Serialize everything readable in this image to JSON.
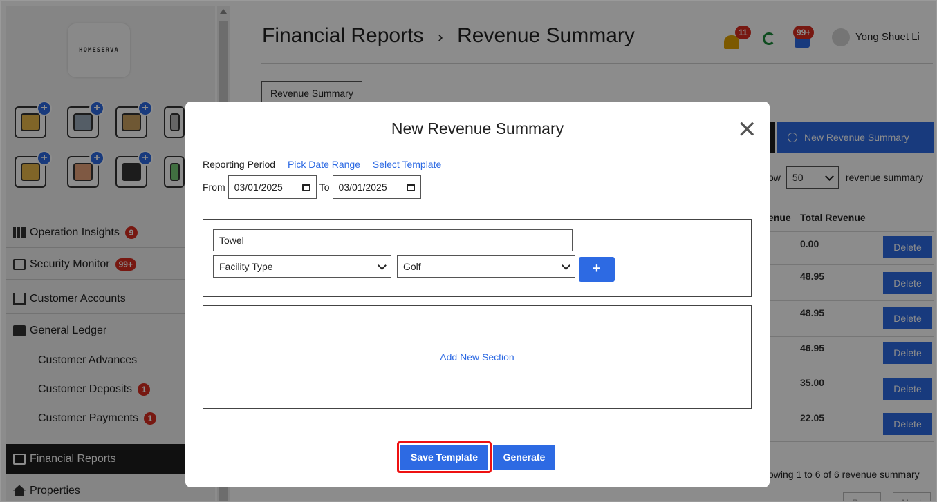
{
  "app": {
    "logo_text": "HOMESERVA"
  },
  "header": {
    "title": "Financial Reports",
    "separator": "›",
    "subtitle": "Revenue Summary",
    "notif_count": "11",
    "message_count": "99+",
    "user_name": "Yong Shuet Li"
  },
  "tabs": [
    {
      "label": "Revenue Summary"
    }
  ],
  "sidebar": {
    "items": [
      {
        "label": "Operation Insights",
        "badge": "9"
      },
      {
        "label": "Security Monitor",
        "badge": "99+"
      },
      {
        "label": "Customer Accounts"
      },
      {
        "label": "General Ledger"
      },
      {
        "label": "Customer Advances"
      },
      {
        "label": "Customer Deposits",
        "badge": "1"
      },
      {
        "label": "Customer Payments",
        "badge": "1"
      },
      {
        "label": "Financial Reports"
      },
      {
        "label": "Properties"
      }
    ]
  },
  "toolbar": {
    "new_button": "New Revenue Summary"
  },
  "list": {
    "show_label": "ow",
    "page_size": "50",
    "show_suffix": "revenue summary",
    "columns": [
      "enue",
      "Total Revenue"
    ],
    "rows": [
      {
        "total": "0.00",
        "action": "Delete"
      },
      {
        "total": "48.95",
        "action": "Delete"
      },
      {
        "total": "48.95",
        "action": "Delete"
      },
      {
        "total": "46.95",
        "action": "Delete"
      },
      {
        "total": "35.00",
        "action": "Delete"
      },
      {
        "total": "22.05",
        "action": "Delete"
      }
    ],
    "showing": "owing 1 to 6 of 6 revenue summary",
    "prev": "Prev",
    "next": "Next"
  },
  "modal": {
    "title": "New Revenue Summary",
    "close": "✕",
    "reporting_period_label": "Reporting Period",
    "pick_date_range": "Pick Date Range",
    "select_template": "Select Template",
    "from_label": "From",
    "from_value": "03/01/2025",
    "to_label": "To",
    "to_value": "03/01/2025",
    "item_name": "Towel",
    "filter_type": "Facility Type",
    "filter_value": "Golf",
    "add_button": "+",
    "add_section": "Add New Section",
    "save_template": "Save Template",
    "generate": "Generate"
  },
  "colors": {
    "accent": "#2d6ae3",
    "badge": "#d92d20",
    "highlight": "#e11111"
  }
}
